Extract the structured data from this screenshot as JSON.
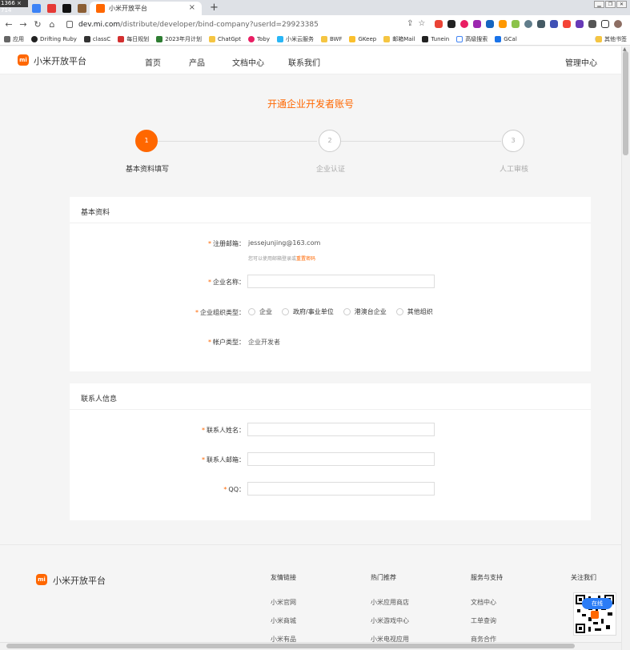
{
  "browser": {
    "resolution_badge": "1366 × 714",
    "active_tab_title": "小米开放平台",
    "url_host": "dev.mi.com",
    "url_path": "/distribute/developer/bind-company?userId=29923385",
    "bookmarks": [
      "应用",
      "Drifting Ruby",
      "classC",
      "每日规划",
      "2023年月计划",
      "ChatGpt",
      "Toby",
      "小米云服务",
      "BWF",
      "GKeep",
      "邮箱Mail",
      "Tunein",
      "高级搜索",
      "GCal"
    ],
    "bookmarks_more": "»",
    "other_bookmarks": "其他书签"
  },
  "header": {
    "logo_text": "mi",
    "site_name": "小米开放平台",
    "nav": [
      "首页",
      "产品",
      "文档中心",
      "联系我们"
    ],
    "admin": "管理中心"
  },
  "page": {
    "title": "开通企业开发者账号",
    "steps": [
      {
        "num": "1",
        "label": "基本资料填写"
      },
      {
        "num": "2",
        "label": "企业认证"
      },
      {
        "num": "3",
        "label": "人工审核"
      }
    ]
  },
  "basic": {
    "section_title": "基本资料",
    "email_label": "注册邮箱：",
    "email_value": "jessejunjing@163.com",
    "email_hint": "您可以使用邮箱登录或",
    "email_hint_link": "重置密码",
    "company_label": "企业名称：",
    "org_type_label": "企业组织类型：",
    "org_types": [
      "企业",
      "政府/事业单位",
      "港澳台企业",
      "其他组织"
    ],
    "account_type_label": "帐户类型：",
    "account_type_value": "企业开发者"
  },
  "contact": {
    "section_title": "联系人信息",
    "name_label": "联系人姓名：",
    "email_label": "联系人邮箱：",
    "qq_label": "QQ："
  },
  "footer": {
    "logo_text": "mi",
    "site_name": "小米开放平台",
    "columns": [
      {
        "title": "友情链接",
        "links": [
          "小米官网",
          "小米商城",
          "小米有品"
        ]
      },
      {
        "title": "热门推荐",
        "links": [
          "小米应用商店",
          "小米游戏中心",
          "小米电视应用"
        ]
      },
      {
        "title": "服务与支持",
        "links": [
          "文档中心",
          "工单查询",
          "商务合作"
        ]
      }
    ],
    "follow_title": "关注我们",
    "chat_label": "在线"
  }
}
